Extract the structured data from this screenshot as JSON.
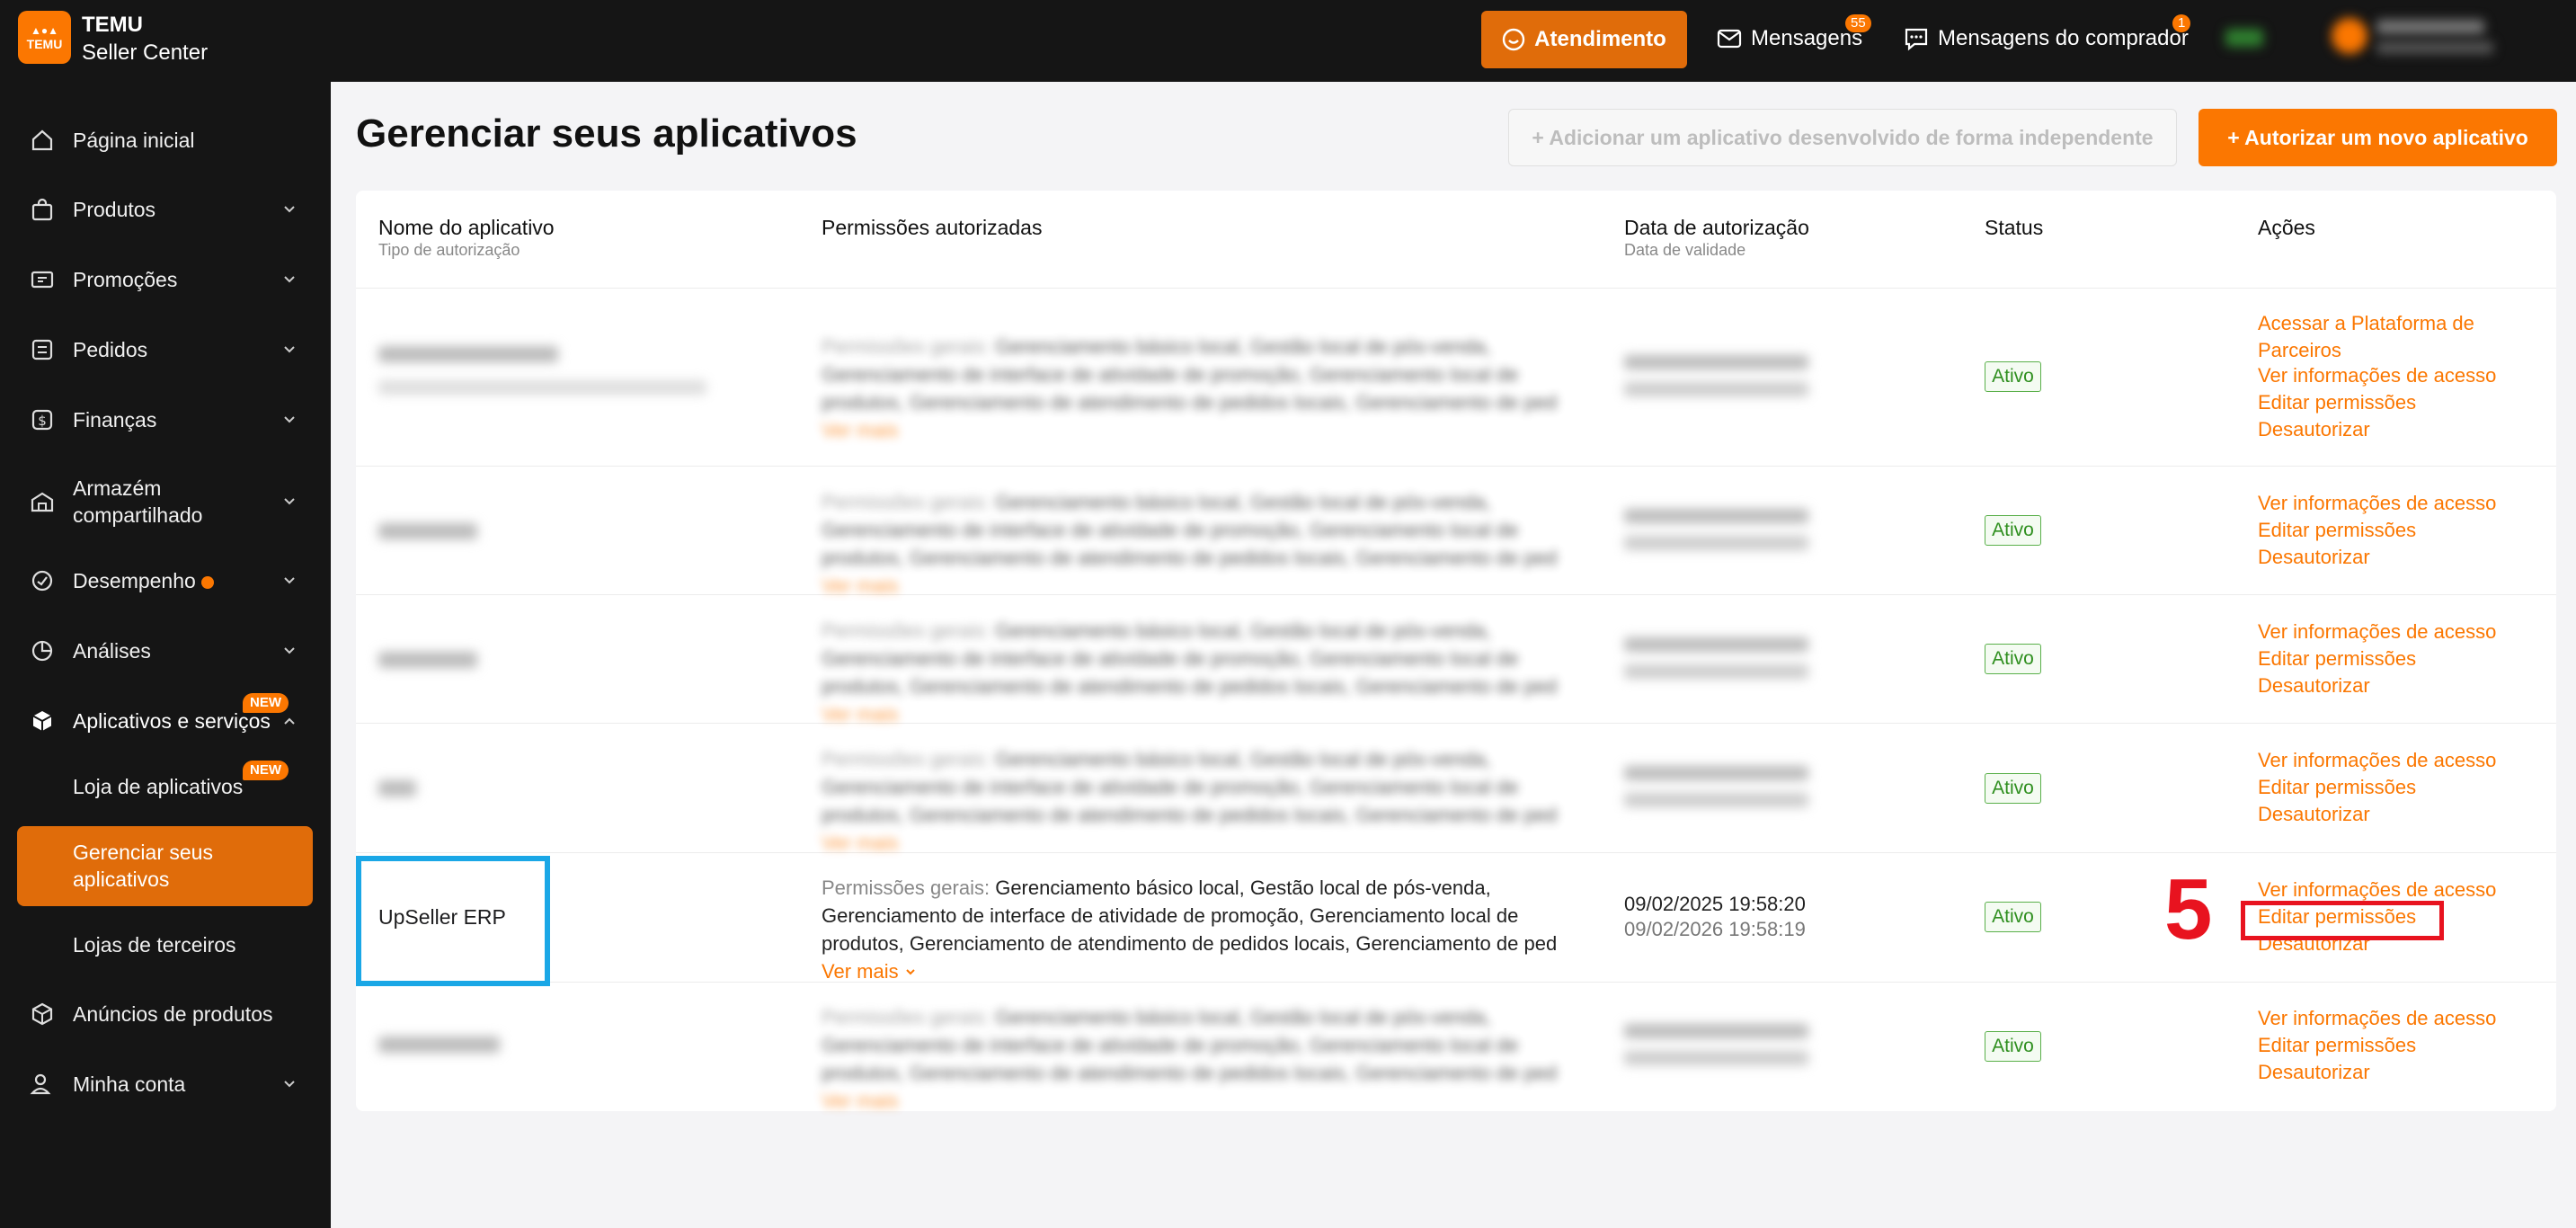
{
  "header": {
    "logo_line1": "TEMU",
    "logo_icon_text": "TEMU",
    "brand_title": "TEMU",
    "brand_subtitle": "Seller Center",
    "atendimento": "Atendimento",
    "mensagens": "Mensagens",
    "mensagens_badge": "55",
    "mensagens_comprador": "Mensagens do comprador",
    "comprador_badge": "1"
  },
  "sidebar": {
    "items": [
      {
        "label": "Página inicial"
      },
      {
        "label": "Produtos"
      },
      {
        "label": "Promoções"
      },
      {
        "label": "Pedidos"
      },
      {
        "label": "Finanças"
      },
      {
        "label": "Armazém compartilhado"
      },
      {
        "label": "Desempenho"
      },
      {
        "label": "Análises"
      },
      {
        "label": "Aplicativos e serviços",
        "badge": "NEW"
      },
      {
        "label": "Anúncios de produtos"
      },
      {
        "label": "Minha conta"
      }
    ],
    "sub_items": [
      {
        "label": "Loja de aplicativos",
        "badge": "NEW"
      },
      {
        "label": "Gerenciar seus aplicativos"
      },
      {
        "label": "Lojas de terceiros"
      }
    ]
  },
  "main": {
    "title": "Gerenciar seus aplicativos",
    "add_independent_button": "+ Adicionar um aplicativo desenvolvido de forma independente",
    "authorize_button": "+ Autorizar um novo aplicativo",
    "columns": {
      "app_name": "Nome do aplicativo",
      "auth_type": "Tipo de autorização",
      "permissions": "Permissões autorizadas",
      "auth_date": "Data de autorização",
      "valid_date": "Data de validade",
      "status": "Status",
      "actions": "Ações"
    },
    "perm_prefix": "Permissões gerais:",
    "perm_text": "Gerenciamento básico local, Gestão local de pós-venda, Gerenciamento de interface de atividade de promoção, Gerenciamento local de produtos, Gerenciamento de atendimento de pedidos locais, Gerenciamento de ped",
    "ver_mais": "Ver mais",
    "status_active": "Ativo",
    "action_platform": "Acessar a Plataforma de Parceiros",
    "action_view": "Ver informações de acesso",
    "action_edit": "Editar permissões",
    "action_deauth": "Desautorizar",
    "visible_row": {
      "app_name": "UpSeller ERP",
      "auth_date": "09/02/2025 19:58:20",
      "valid_date": "09/02/2026 19:58:19"
    }
  },
  "annotation": {
    "step_number": "5",
    "highlight_color": "#e8131f",
    "app_highlight_color": "#1aa7e6"
  },
  "colors": {
    "brand_orange": "#fb7701",
    "active_nav": "#e06c0a",
    "sidebar_bg": "#151515",
    "status_green": "#2f8f1f"
  }
}
